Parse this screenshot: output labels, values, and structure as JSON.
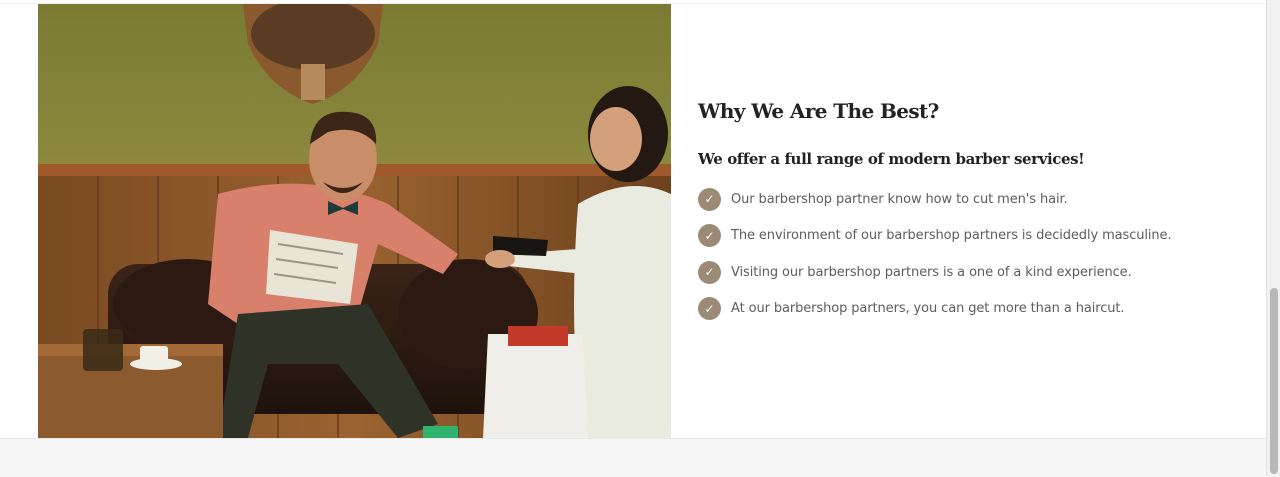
{
  "section": {
    "heading": "Why We Are The Best?",
    "subheading": "We offer a full range of modern barber services!",
    "features": [
      {
        "icon": "check-icon",
        "text": "Our barbershop partner know how to cut men's hair."
      },
      {
        "icon": "check-icon",
        "text": "The environment of our barbershop partners is decidedly masculine."
      },
      {
        "icon": "check-icon",
        "text": "Visiting our barbershop partners is a one of a kind experience."
      },
      {
        "icon": "check-icon",
        "text": "At our barbershop partners, you can get more than a haircut."
      }
    ]
  },
  "colors": {
    "accent": "#9b8a75",
    "heading": "#222222",
    "body_text": "#5d5d5d"
  }
}
